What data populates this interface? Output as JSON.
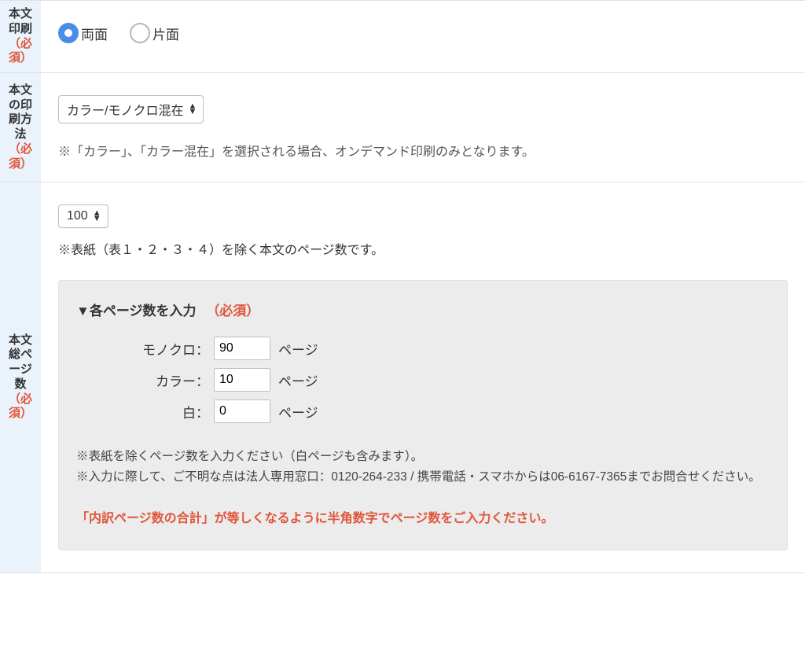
{
  "rows": {
    "printSides": {
      "label": "本文印刷",
      "required": "（必須）",
      "options": {
        "duplex": "両面",
        "simplex": "片面"
      },
      "selected": "duplex"
    },
    "printMethod": {
      "label": "本文の印刷方法",
      "required": "（必須）",
      "selectValue": "カラー/モノクロ混在",
      "note": "※「カラー」、「カラー混在」を選択される場合、オンデマンド印刷のみとなります。"
    },
    "totalPages": {
      "label": "本文総ページ数",
      "required": "（必須）",
      "totalSelectValue": "100",
      "topNote": "※表紙（表１・２・３・４）を除く本文のページ数です。",
      "panel": {
        "heading": "▼各ページ数を入力",
        "headingRequired": "（必須）",
        "fields": {
          "mono": {
            "label": "モノクロ：",
            "value": "90",
            "unit": "ページ"
          },
          "color": {
            "label": "カラー：",
            "value": "10",
            "unit": "ページ"
          },
          "blank": {
            "label": "白：",
            "value": "0",
            "unit": "ページ"
          }
        },
        "note1": "※表紙を除くページ数を入力ください（白ページも含みます）。",
        "note2": "※入力に際して、ご不明な点は法人専用窓口：0120-264-233 / 携帯電話・スマホからは06-6167-7365までお問合せください。",
        "alert": "「内訳ページ数の合計」が等しくなるように半角数字でページ数をご入力ください。"
      }
    }
  }
}
